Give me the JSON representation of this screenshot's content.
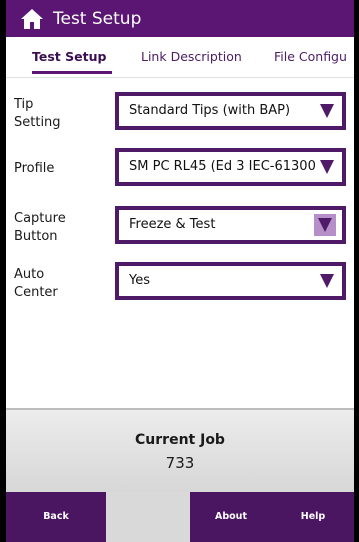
{
  "titlebar": {
    "title": "Test Setup",
    "icon": "home-icon",
    "background": "#5b1573"
  },
  "tabs": [
    {
      "label": "Test Setup",
      "active": true
    },
    {
      "label": "Link Description",
      "active": false
    },
    {
      "label": "File Configu",
      "active": false
    }
  ],
  "settings": [
    {
      "label_lines": [
        "Tip",
        "Setting"
      ],
      "value": "Standard Tips (with BAP)"
    },
    {
      "label_lines": [
        "Profile"
      ],
      "value": "SM PC RL45 (Ed 3 IEC-61300"
    },
    {
      "label_lines": [
        "Capture",
        "Button"
      ],
      "value": "Freeze & Test"
    },
    {
      "label_lines": [
        "Auto",
        "Center"
      ],
      "value": "Yes"
    }
  ],
  "current_job": {
    "label": "Current Job",
    "value": "733"
  },
  "footer": {
    "back": "Back",
    "about": "About",
    "help": "Help"
  },
  "colors": {
    "accent": "#5b1573",
    "dropdown_border": "#4f1a68",
    "footer": "#4a1561"
  }
}
